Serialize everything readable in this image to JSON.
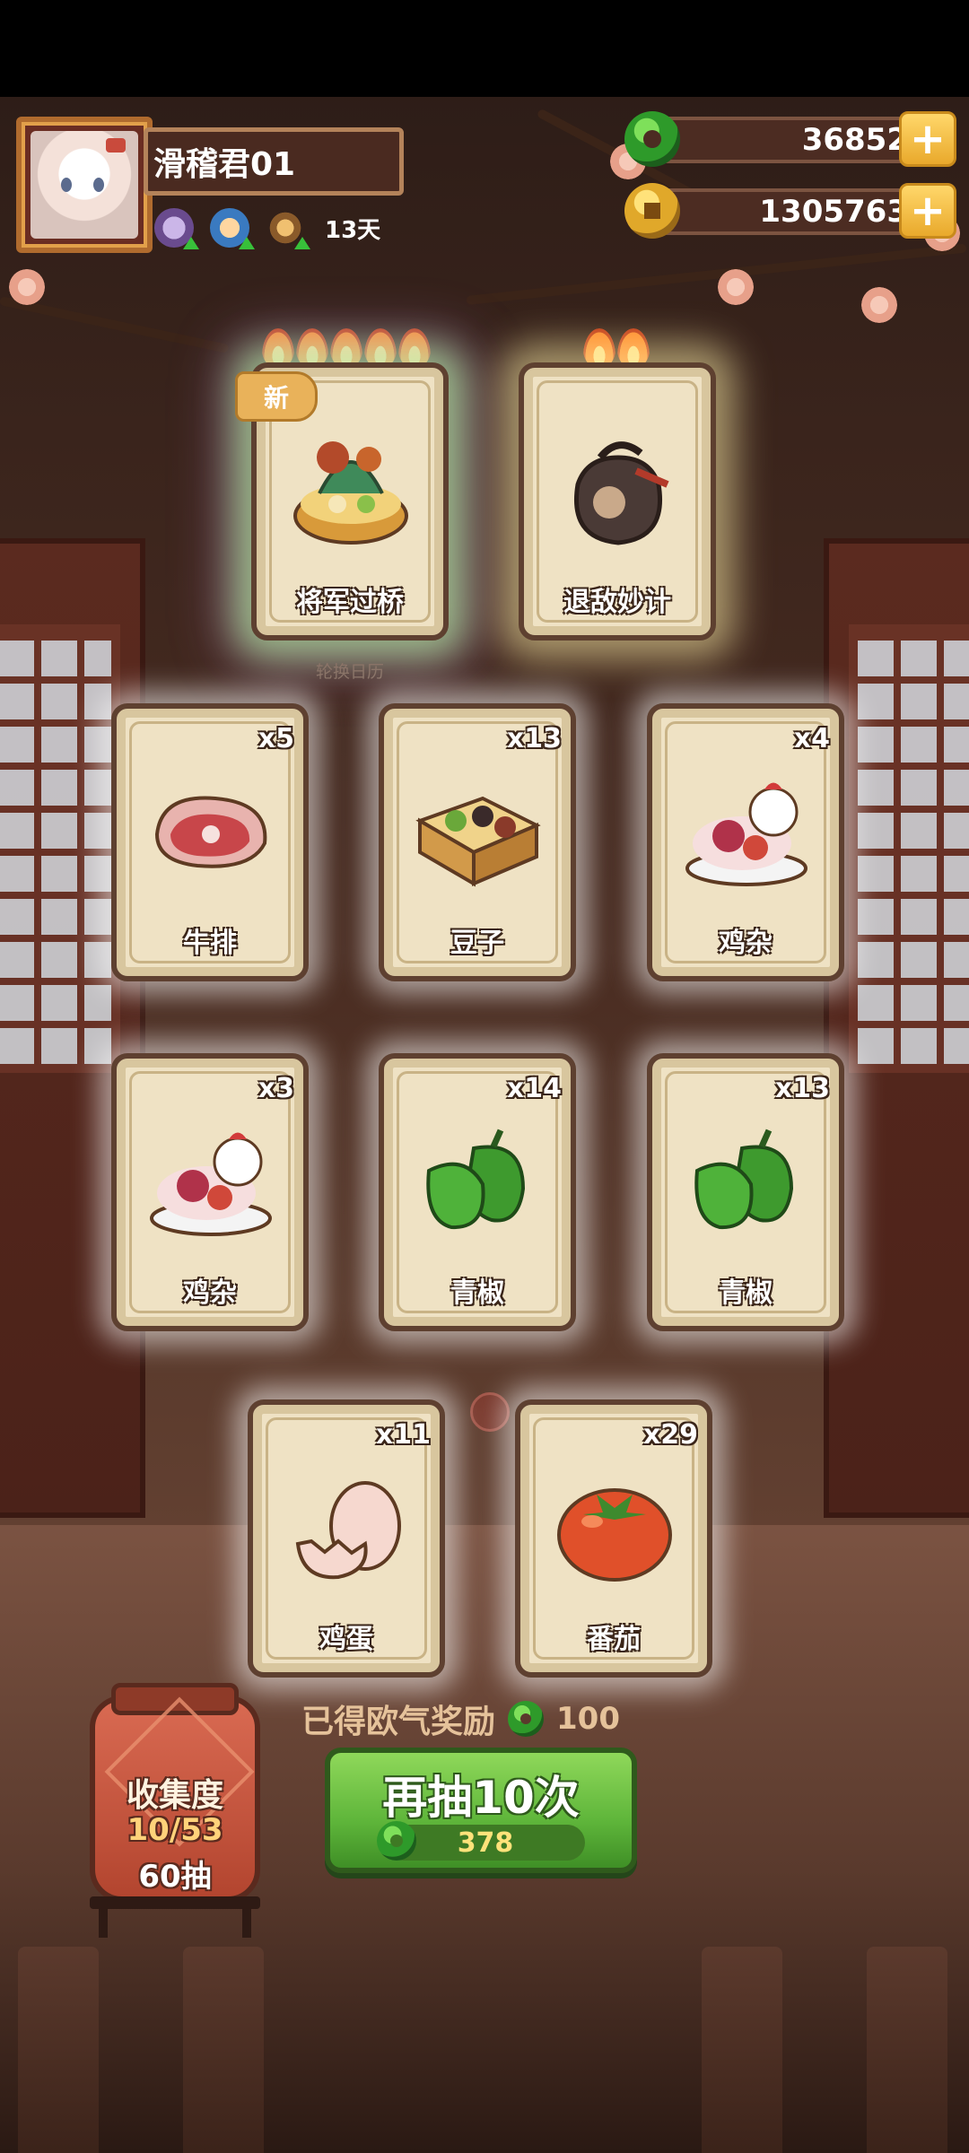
{
  "player": {
    "name": "滑稽君01",
    "days": "13天"
  },
  "currency": {
    "jade": "36852",
    "gold": "1305763"
  },
  "featured_cards": [
    {
      "name": "将军过桥",
      "flames": 5,
      "badge": "新"
    },
    {
      "name": "退敌妙计",
      "flames": 2
    }
  ],
  "calendar_label": "轮换日历",
  "cards": [
    {
      "name": "牛排",
      "count": "x5",
      "icon": "steak-icon"
    },
    {
      "name": "豆子",
      "count": "x13",
      "icon": "beans-box-icon"
    },
    {
      "name": "鸡杂",
      "count": "x4",
      "icon": "chicken-icon"
    },
    {
      "name": "鸡杂",
      "count": "x3",
      "icon": "chicken-icon"
    },
    {
      "name": "青椒",
      "count": "x14",
      "icon": "green-pepper-icon"
    },
    {
      "name": "青椒",
      "count": "x13",
      "icon": "green-pepper-icon"
    },
    {
      "name": "鸡蛋",
      "count": "x11",
      "icon": "egg-icon"
    },
    {
      "name": "番茄",
      "count": "x29",
      "icon": "tomato-icon"
    }
  ],
  "reward": {
    "label": "已得欧气奖励",
    "value": "100"
  },
  "collection": {
    "title": "收集度",
    "progress": "10/53",
    "pulls": "60抽"
  },
  "draw_button": {
    "label": "再抽10次",
    "cost": "378"
  },
  "colors": {
    "jade": "#2e9a2a",
    "gold": "#e0a82a",
    "button_green": "#5eb53a",
    "card_bg": "#efe2c4"
  }
}
